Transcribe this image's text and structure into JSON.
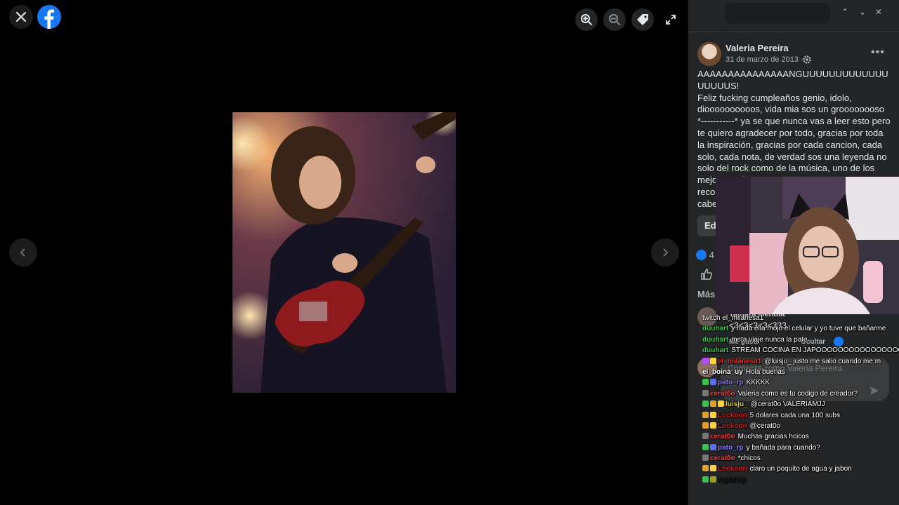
{
  "viewer": {
    "icons": {
      "close": "close-icon",
      "logo": "facebook-logo",
      "zoom_in": "zoom-in-icon",
      "zoom_out": "zoom-out-icon",
      "tag": "tag-icon",
      "fullscreen": "fullscreen-icon",
      "prev": "chevron-left-icon",
      "next": "chevron-right-icon"
    },
    "colors": {
      "background": "#000000",
      "brand": "#1877f2"
    }
  },
  "post": {
    "author": "Valeria Pereira",
    "date": "31 de marzo de 2013",
    "separator": "·",
    "text": "AAAAAAAAAAAAAAANGUUUUUUUUUUUUUUUUUUS!\nFeliz fucking cumpleaños genio, idolo, dioooooooooos, vida mia sos un groooooooso *-----------* ya se que nunca vas a leer esto pero te quiero agradecer por todo, gracias por toda la inspiración, gracias por cada cancion, cada solo, cada nota, de verdad sos una leyenda no solo del rock como de la música, uno de los mejores guita",
    "text_tail": [
      "reco",
      "cabe"
    ],
    "edit_label": "Ed",
    "likes_count": "4",
    "more_comments": "Más",
    "comment": {
      "author": "Tamara Mendia",
      "text": "<3<3<3<3<333",
      "like_label": "Me gusta",
      "hide_label": "Ocultar"
    },
    "comment_placeholder": "Comenta como Valeria Pereira"
  },
  "chat": [
    {
      "user": "",
      "text": "twitch el_milanesa1",
      "color": "#ffffff",
      "badges": []
    },
    {
      "user": "duuhart",
      "text": "y nada ella mojo el celular y yo tuve que bañarme",
      "color": "#2ecc40",
      "badges": []
    },
    {
      "user": "duuhart",
      "text": "meta viaje nunca la pate",
      "color": "#2ecc40",
      "badges": []
    },
    {
      "user": "duuhart",
      "text": "STREAM COCINA EN JAPOOOOOOOOOOOOOOOON",
      "color": "#2ecc40",
      "badges": []
    },
    {
      "user": "el_milanesa1",
      "text": "@luisju_ justo me salio cuando me m",
      "color": "#ff2020",
      "badges": [
        "#b44cff",
        "#ffd23f"
      ]
    },
    {
      "user": "el_boina_uy",
      "text": "Hola buenas",
      "color": "#ffffff",
      "badges": []
    },
    {
      "user": "pato_rp",
      "text": "KKKKK",
      "color": "#8a7cff",
      "badges": [
        "#3fbf4f",
        "#5b6cff"
      ]
    },
    {
      "user": "cerat0o",
      "text": "Valeria como es tu codigo de creador?",
      "color": "#ff3b3b",
      "badges": [
        "#777777"
      ]
    },
    {
      "user": "luisju_",
      "text": "@cerat0o VALERIAMJJ",
      "color": "#d8d021",
      "badges": [
        "#3fbf4f",
        "#e0a030",
        "#ffd23f"
      ]
    },
    {
      "user": "Lockoon",
      "text": "5 dolares cada una 100 subs",
      "color": "#d11a1a",
      "badges": [
        "#e0a030",
        "#ffd23f"
      ]
    },
    {
      "user": "Lockoon",
      "text": "@cerat0o",
      "color": "#d11a1a",
      "badges": [
        "#e0a030",
        "#ffd23f"
      ]
    },
    {
      "user": "cerat0o",
      "text": "Muchas gracias hcicos",
      "color": "#ff3b3b",
      "badges": [
        "#777777"
      ]
    },
    {
      "user": "pato_rp",
      "text": "y bañada para cuando?",
      "color": "#8a7cff",
      "badges": [
        "#3fbf4f",
        "#5b6cff"
      ]
    },
    {
      "user": "cerat0o",
      "text": "*chicos",
      "color": "#ff3b3b",
      "badges": [
        "#777777"
      ]
    },
    {
      "user": "Lockoon",
      "text": "claro un poquito de agua y jabon",
      "color": "#d11a1a",
      "badges": [
        "#e0a030",
        "#ffd23f"
      ]
    },
    {
      "user": "Agrisbip",
      "text": "",
      "color": "#222222",
      "badges": [
        "#3fbf4f",
        "#a0a020"
      ]
    }
  ]
}
